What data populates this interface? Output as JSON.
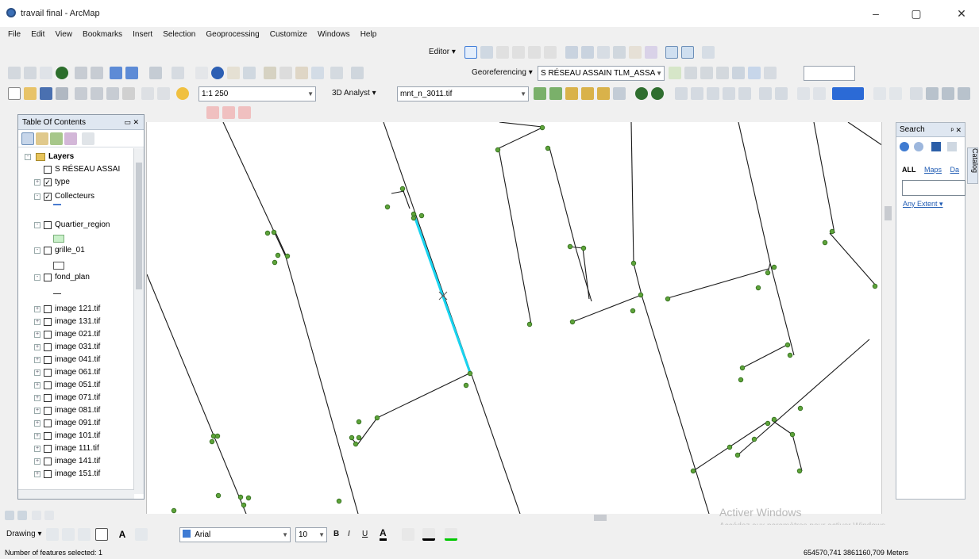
{
  "window": {
    "title": "travail final - ArcMap",
    "controls": {
      "minimize": "–",
      "maximize": "▢",
      "close": "✕"
    }
  },
  "menu": [
    "File",
    "Edit",
    "View",
    "Bookmarks",
    "Insert",
    "Selection",
    "Geoprocessing",
    "Customize",
    "Windows",
    "Help"
  ],
  "toolbars": {
    "editor_label": "Editor ▾",
    "georeferencing_label": "Georeferencing ▾",
    "georeferencing_layer": "S RÉSEAU ASSAIN TLM_ASSA",
    "scale": "1:1 250",
    "analyst3d_label": "3D Analyst ▾",
    "analyst3d_layer": "mnt_n_3011.tif",
    "font_name": "Arial",
    "font_size": "10",
    "drawing_label": "Drawing ▾",
    "bold": "B",
    "italic": "I",
    "underline": "U",
    "text_color_glyph": "A"
  },
  "toc": {
    "title": "Table Of Contents",
    "root": "Layers",
    "layers": [
      {
        "label": "S RÉSEAU ASSAI",
        "checked": false,
        "expander": ""
      },
      {
        "label": "type",
        "checked": true,
        "expander": "+"
      },
      {
        "label": "Collecteurs",
        "checked": true,
        "expander": "-"
      },
      {
        "label": "Quartier_region",
        "checked": false,
        "expander": "-"
      },
      {
        "label": "grille_01",
        "checked": false,
        "expander": "-"
      },
      {
        "label": "fond_plan",
        "checked": false,
        "expander": "-"
      },
      {
        "label": "image 121.tif",
        "checked": false,
        "expander": "+"
      },
      {
        "label": "image 131.tif",
        "checked": false,
        "expander": "+"
      },
      {
        "label": "image 021.tif",
        "checked": false,
        "expander": "+"
      },
      {
        "label": "image 031.tif",
        "checked": false,
        "expander": "+"
      },
      {
        "label": "image 041.tif",
        "checked": false,
        "expander": "+"
      },
      {
        "label": "image 061.tif",
        "checked": false,
        "expander": "+"
      },
      {
        "label": "image 051.tif",
        "checked": false,
        "expander": "+"
      },
      {
        "label": "image 071.tif",
        "checked": false,
        "expander": "+"
      },
      {
        "label": "image 081.tif",
        "checked": false,
        "expander": "+"
      },
      {
        "label": "image 091.tif",
        "checked": false,
        "expander": "+"
      },
      {
        "label": "image 101.tif",
        "checked": false,
        "expander": "+"
      },
      {
        "label": "image 111.tif",
        "checked": false,
        "expander": "+"
      },
      {
        "label": "image 141.tif",
        "checked": false,
        "expander": "+"
      },
      {
        "label": "image 151.tif",
        "checked": false,
        "expander": "+"
      }
    ]
  },
  "search": {
    "title": "Search",
    "tabs": {
      "all": "ALL",
      "maps": "Maps",
      "data": "Da"
    },
    "input_value": "",
    "extent_link": "Any Extent ▾"
  },
  "catalog_tab": "Catalog",
  "watermark": {
    "line1": "Activer Windows",
    "line2": "Accédez aux paramètres pour activer Windows."
  },
  "status": {
    "selected": "Number of features selected: 1",
    "coords": "654570,741 3861160,709 Meters"
  },
  "colors": {
    "line": "#1a1a1a",
    "node": "#5ea33a",
    "node_stroke": "#2f6a1b",
    "selected": "#19d4f0"
  }
}
